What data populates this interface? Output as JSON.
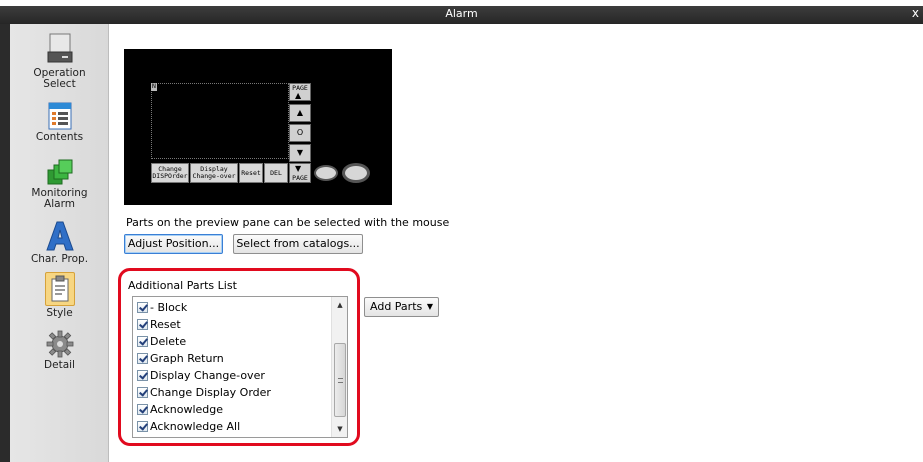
{
  "window": {
    "title": "Alarm",
    "close_glyph": "x"
  },
  "sidebar": {
    "items": [
      {
        "label": "Operation\nSelect",
        "icon": "operation-select-icon"
      },
      {
        "label": "Contents",
        "icon": "contents-icon"
      },
      {
        "label": "Monitoring\nAlarm",
        "icon": "monitoring-alarm-icon"
      },
      {
        "label": "Char. Prop.",
        "icon": "char-prop-icon"
      },
      {
        "label": "Style",
        "icon": "style-icon"
      },
      {
        "label": "Detail",
        "icon": "gear-icon"
      }
    ]
  },
  "preview": {
    "page_up": "PAGE",
    "page_down": "PAGE",
    "stop": "O",
    "change_order": "Change\nDISPOrder",
    "display_changeover": "Display\nChange-over",
    "reset": "Reset",
    "del": "DEL",
    "corner": "N"
  },
  "main": {
    "note": "Parts on the preview pane can be selected with the mouse",
    "adjust_button": "Adjust Position...",
    "catalog_button": "Select from catalogs...",
    "additional_title": "Additional Parts List",
    "add_parts_button": "Add Parts",
    "parts": [
      {
        "label": "- Block",
        "checked": true
      },
      {
        "label": "Reset",
        "checked": true
      },
      {
        "label": "Delete",
        "checked": true
      },
      {
        "label": "Graph Return",
        "checked": true
      },
      {
        "label": "Display Change-over",
        "checked": true
      },
      {
        "label": "Change Display Order",
        "checked": true
      },
      {
        "label": "Acknowledge",
        "checked": true
      },
      {
        "label": "Acknowledge All",
        "checked": true
      }
    ]
  },
  "colors": {
    "highlight": "#e10a1e",
    "titlebar": "#2f2f2f"
  }
}
